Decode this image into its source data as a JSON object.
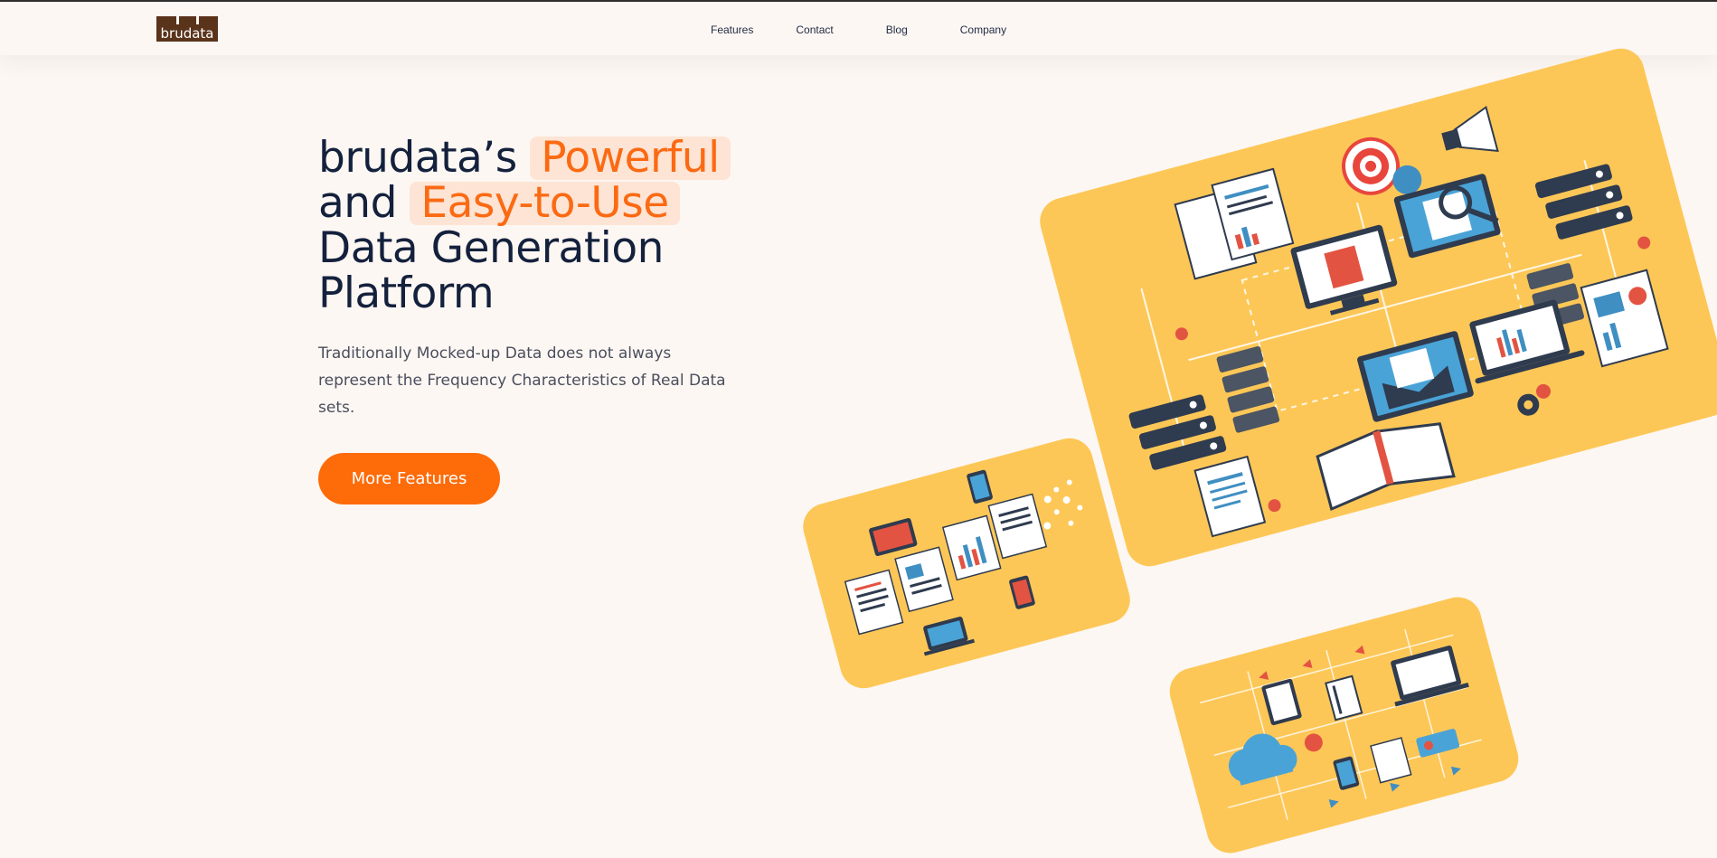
{
  "brand": {
    "logo_text": "brudata"
  },
  "nav": {
    "items": [
      {
        "label": "Features"
      },
      {
        "label": "Contact"
      },
      {
        "label": "Blog"
      },
      {
        "label": "Company"
      }
    ]
  },
  "hero": {
    "title_prefix": "brudata’s",
    "highlight_1": "Powerful",
    "title_and": "and",
    "highlight_2": "Easy-to-Use",
    "title_line_3": "Data Generation",
    "title_line_4": "Platform",
    "subtitle": "Traditionally Mocked-up Data does not always represent the Frequency Characteristics of Real Data sets.",
    "cta_label": "More Features"
  },
  "colors": {
    "background": "#fdf7f3",
    "accent": "#fe6b09",
    "highlight_bg": "#fde4d4",
    "heading": "#14213d",
    "card": "#fdc757",
    "logo_bg": "#5a331b"
  }
}
